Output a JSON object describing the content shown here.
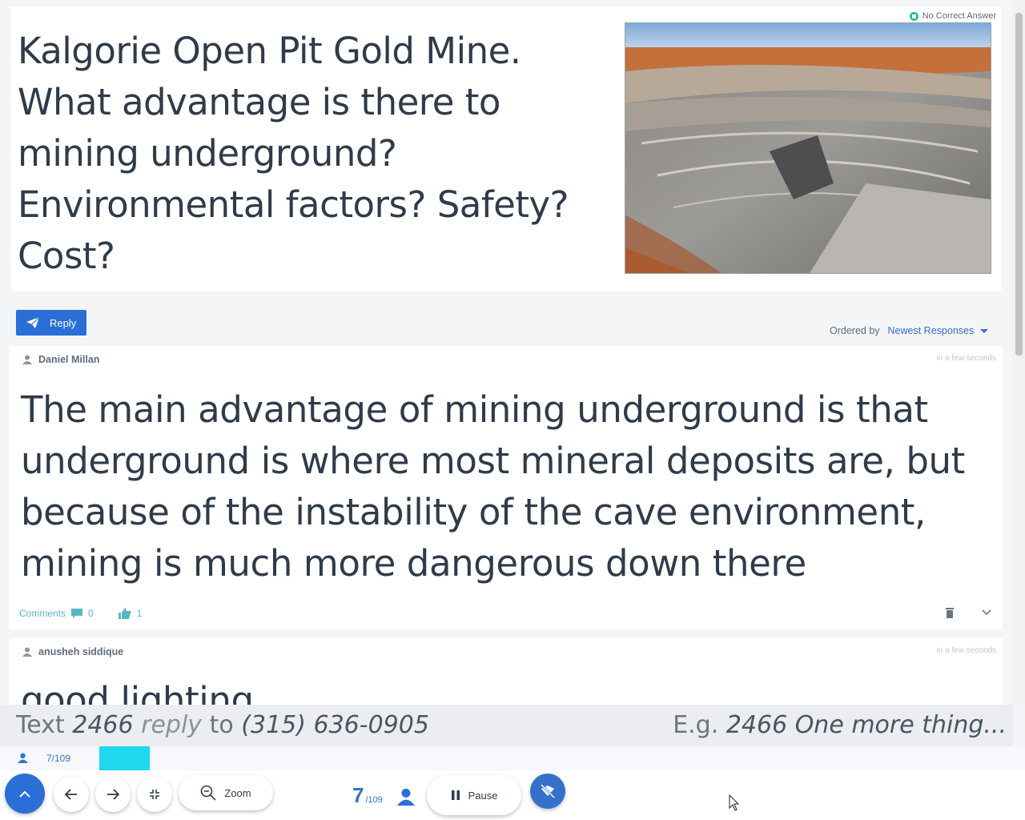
{
  "question": {
    "text": "Kalgorie Open Pit Gold Mine.  What advantage is there to mining underground?  Environmental factors? Safety? Cost?",
    "badge": "No Correct Answer"
  },
  "reply_label": "Reply",
  "ordering": {
    "label": "Ordered by",
    "value": "Newest Responses"
  },
  "responses": [
    {
      "author": "Daniel Millan",
      "time": "in a few seconds",
      "text": "The main advantage of mining underground is that underground is where most mineral deposits are, but because of the instability of the cave environment, mining is much more dangerous down there",
      "comments_label": "Comments",
      "comments_count": "0",
      "likes": "1"
    },
    {
      "author": "anusheh siddique",
      "time": "in a few seconds",
      "text": "good lighting"
    }
  ],
  "sms": {
    "prefix": "Text",
    "code": "2466",
    "keyword": "reply",
    "to": "to",
    "phone": "(315) 636-0905",
    "eg": "E.g.",
    "example": "2466 One more thing..."
  },
  "progress": {
    "count": "7/109",
    "fraction": 0.0545
  },
  "controls": {
    "zoom_label": "Zoom",
    "current": "7",
    "total": "/109",
    "pause_label": "Pause"
  },
  "colors": {
    "accent": "#2a6fd6",
    "progress": "#1fd7ef",
    "text": "#2f3b4a"
  }
}
